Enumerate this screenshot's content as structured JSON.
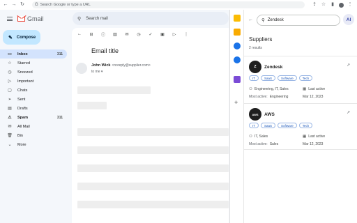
{
  "browser": {
    "url_placeholder": "Search Google or type a URL"
  },
  "gmail": {
    "brand": "Gmail",
    "search_placeholder": "Search mail",
    "compose_label": "Compose",
    "sidebar": [
      {
        "label": "Inbox",
        "count": "311",
        "icon": "inbox-icon"
      },
      {
        "label": "Starred",
        "count": "",
        "icon": "star-icon"
      },
      {
        "label": "Snoozed",
        "count": "",
        "icon": "clock-icon"
      },
      {
        "label": "Important",
        "count": "",
        "icon": "important-icon"
      },
      {
        "label": "Chats",
        "count": "",
        "icon": "chat-icon"
      },
      {
        "label": "Sent",
        "count": "",
        "icon": "send-icon"
      },
      {
        "label": "Drafts",
        "count": "",
        "icon": "draft-icon"
      },
      {
        "label": "Spam",
        "count": "311",
        "icon": "spam-icon"
      },
      {
        "label": "All Mail",
        "count": "",
        "icon": "mail-icon"
      },
      {
        "label": "Bin",
        "count": "",
        "icon": "trash-icon"
      },
      {
        "label": "More",
        "count": "",
        "icon": "chevron-down-icon"
      }
    ],
    "email": {
      "title": "Email title",
      "sender_name": "John Wick",
      "sender_email": "<noreply@supplier.com>",
      "to": "to me"
    }
  },
  "panel": {
    "search_value": "Zendesk",
    "ai_label": "AI",
    "title": "Suppliers",
    "results": "2 results",
    "suppliers": [
      {
        "name": "Zendesk",
        "logo_text": "Z",
        "tags": [
          "IT",
          "SaaS",
          "Software",
          "Tech"
        ],
        "departments": "Engineering, IT, Sales",
        "status_label": "Last active",
        "most_active_label": "Most active:",
        "most_active": "Engineering",
        "date": "Mar 12, 2023"
      },
      {
        "name": "AWS",
        "logo_text": "AWS",
        "tags": [
          "IT",
          "SaaS",
          "Software",
          "Tech"
        ],
        "departments": "IT, Sales",
        "status_label": "Last active",
        "most_active_label": "Most active:",
        "most_active": "Sales",
        "date": "Mar 12, 2023"
      }
    ]
  },
  "colors": {
    "accent": "#0b57d0",
    "compose_bg": "#c2e7ff",
    "active_bg": "#d3e3fd"
  }
}
